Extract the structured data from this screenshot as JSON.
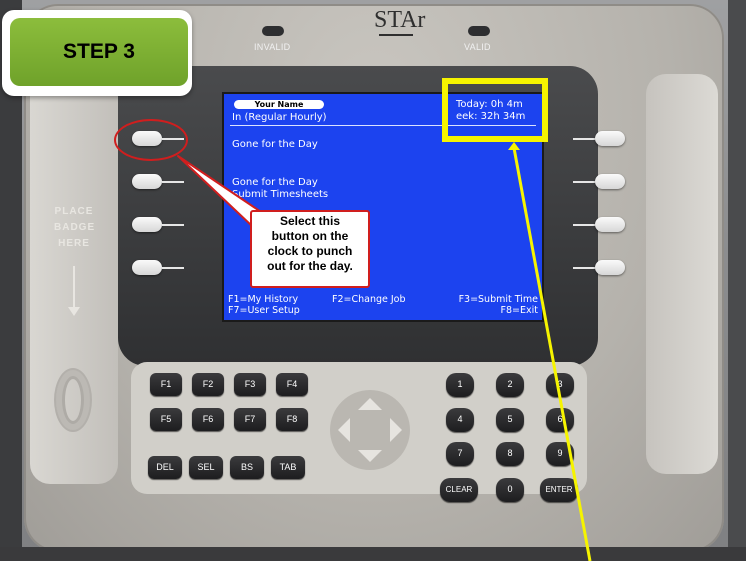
{
  "step_badge": {
    "label": "STEP 3",
    "color": "#79ad31"
  },
  "device": {
    "logo": "STAr",
    "led_left_label": "INVALID",
    "led_right_label": "VALID",
    "badge_label_lines": [
      "PLACE",
      "BADGE",
      "HERE"
    ]
  },
  "screen": {
    "background": "#1c43ef",
    "user_name": "Your Name",
    "status": "In (Regular Hourly)",
    "today": "Today: 0h 4m",
    "week": "eek: 32h 34m",
    "option_1": "Gone for the Day",
    "option_2_line1": "Gone for the Day",
    "option_2_line2": "Submit Timesheets",
    "fkeys": {
      "f1": "F1=My History",
      "f2": "F2=Change Job",
      "f3": "F3=Submit Time",
      "f7": "F7=User Setup",
      "f8": "F8=Exit"
    }
  },
  "callout": {
    "text_lines": [
      "Select this",
      "button on the",
      "clock to punch",
      "out for the day."
    ],
    "border_color": "#d01e1e"
  },
  "highlight": {
    "color": "#f6f400"
  },
  "keypad": {
    "function_keys": [
      "F1",
      "F2",
      "F3",
      "F4",
      "F5",
      "F6",
      "F7",
      "F8"
    ],
    "edit_keys": [
      "DEL",
      "SEL",
      "BS",
      "TAB"
    ],
    "digits": [
      "1",
      "2",
      "3",
      "4",
      "5",
      "6",
      "7",
      "8",
      "9",
      "0"
    ],
    "clear_label": "CLEAR",
    "enter_label": "ENTER"
  }
}
